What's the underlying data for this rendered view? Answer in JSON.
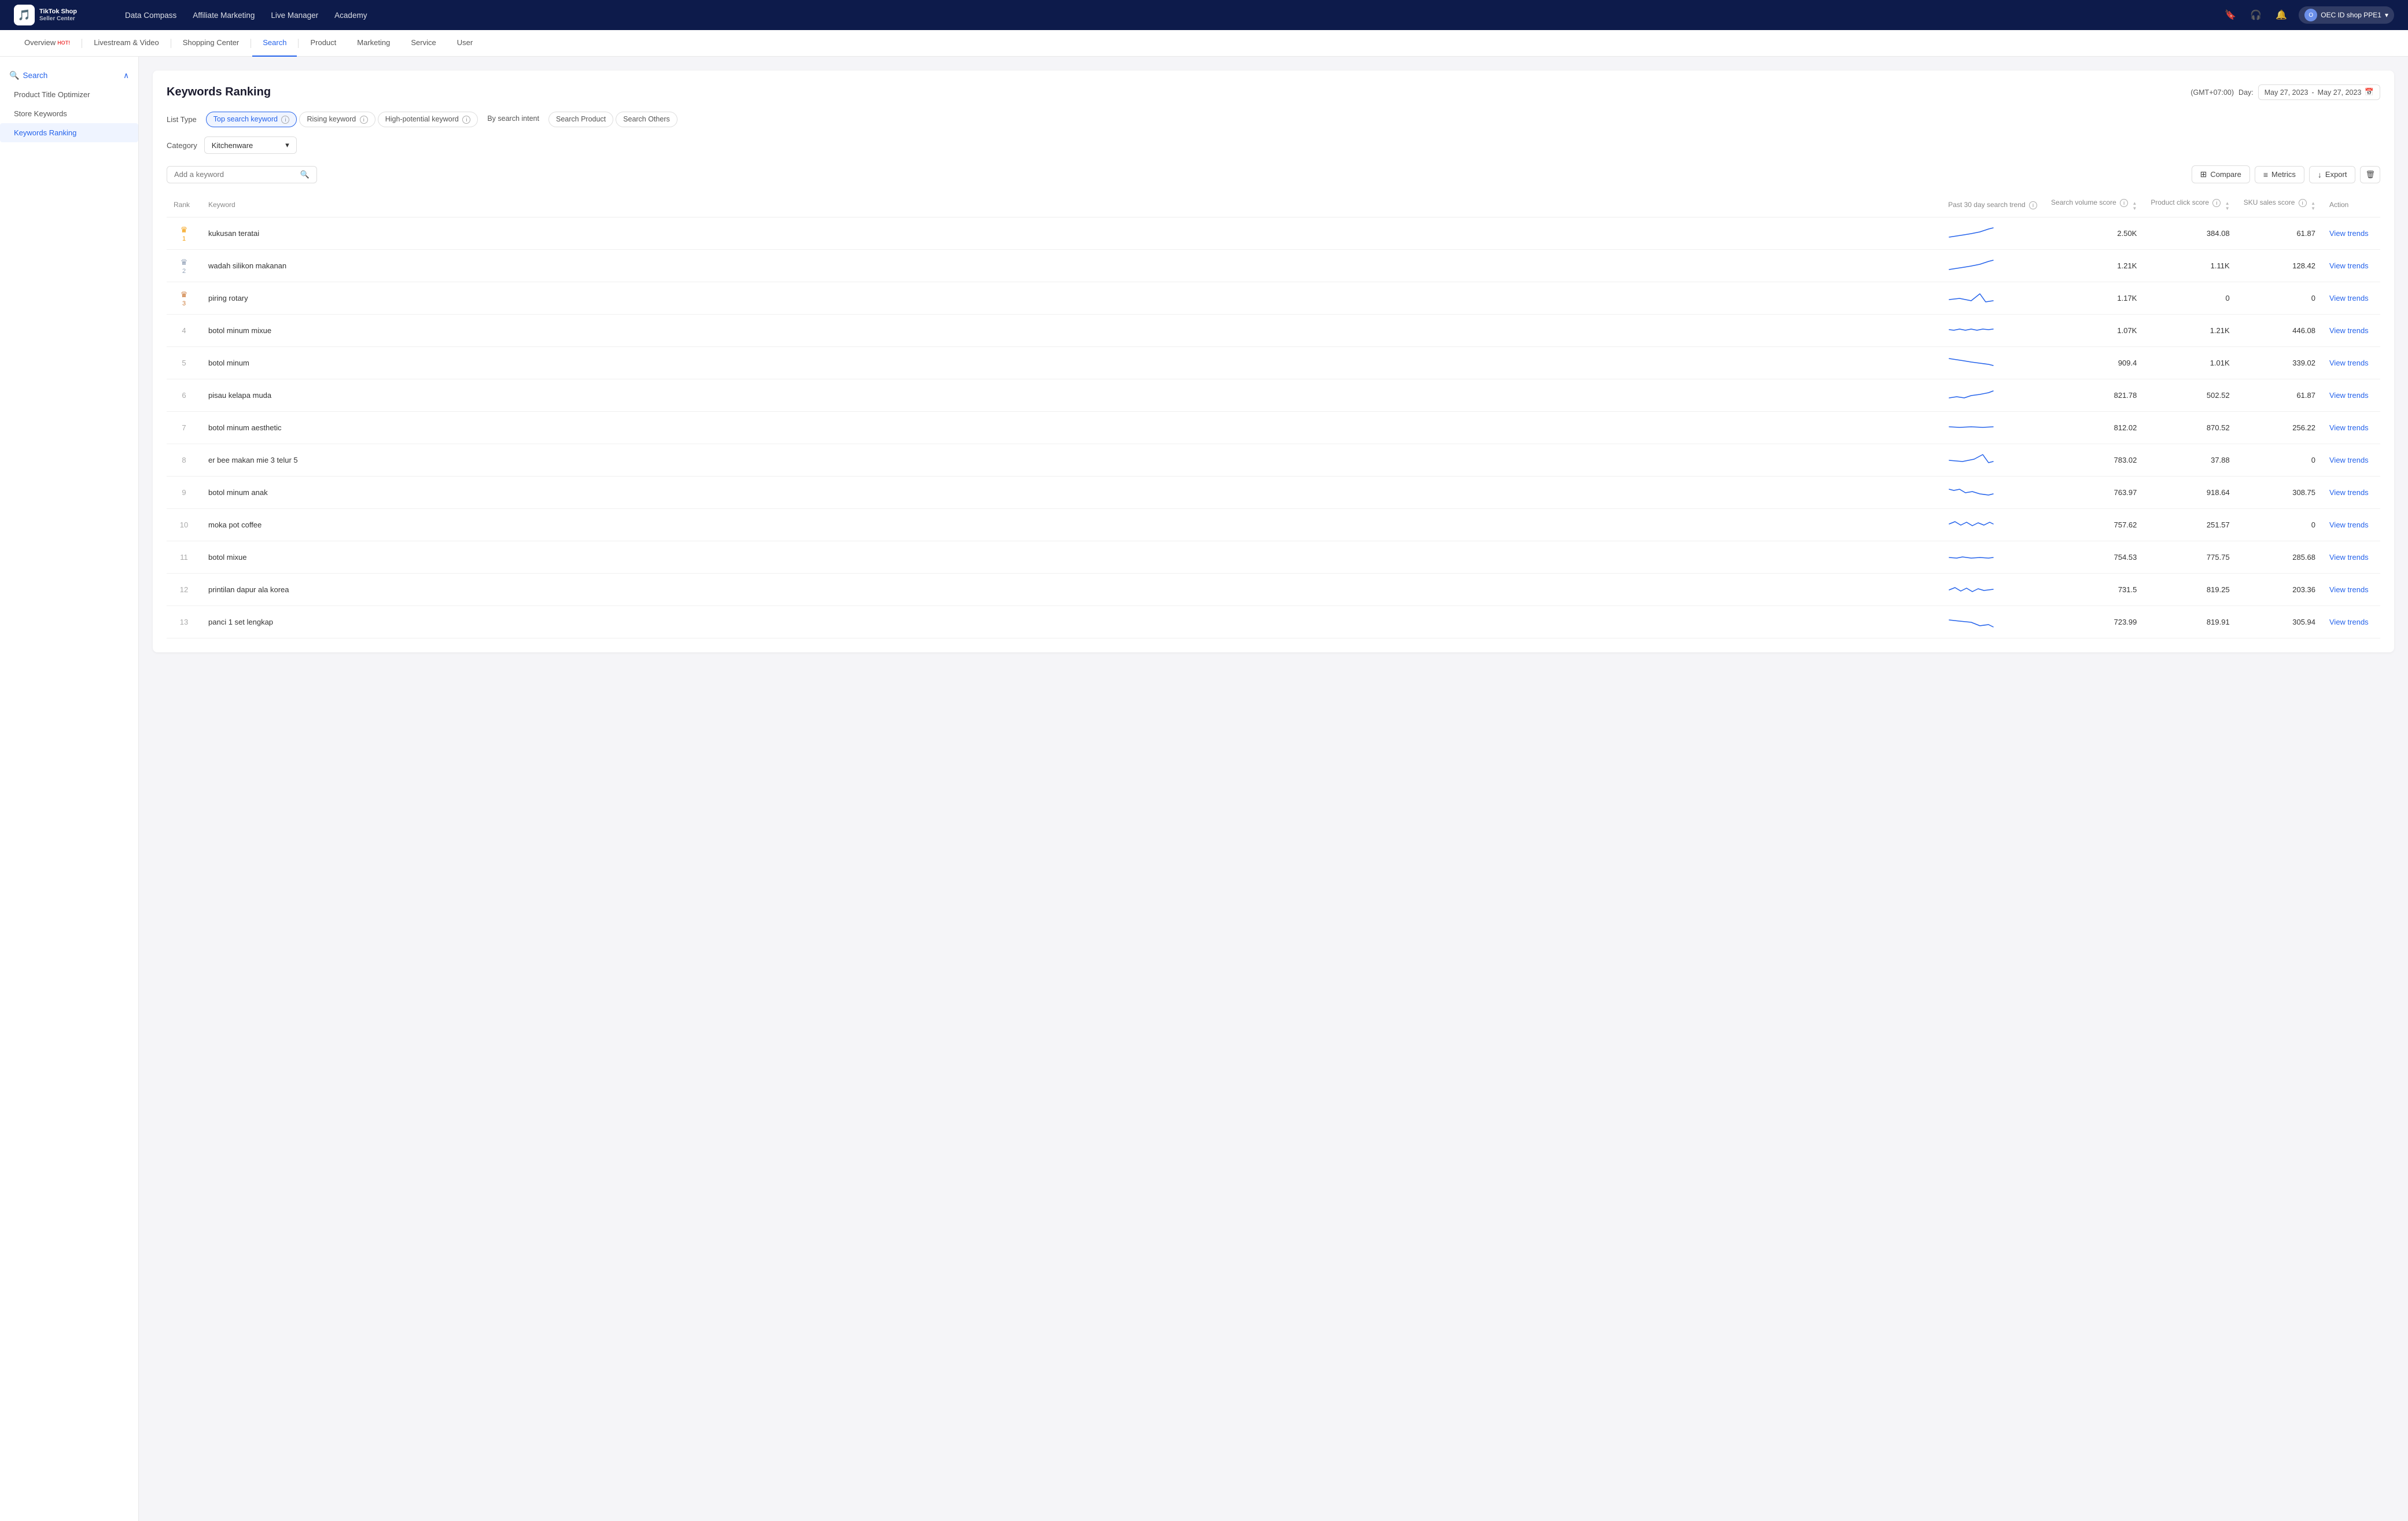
{
  "topNav": {
    "logo": "TikTok Shop Seller Center",
    "links": [
      "Data Compass",
      "Affiliate Marketing",
      "Live Manager",
      "Academy"
    ],
    "userLabel": "OEC ID shop PPE1"
  },
  "secondNav": {
    "items": [
      {
        "label": "Overview",
        "hot": true,
        "active": false
      },
      {
        "label": "Livestream & Video",
        "hot": false,
        "active": false
      },
      {
        "label": "Shopping Center",
        "hot": false,
        "active": false
      },
      {
        "label": "Search",
        "hot": false,
        "active": true
      },
      {
        "label": "Product",
        "hot": false,
        "active": false
      },
      {
        "label": "Marketing",
        "hot": false,
        "active": false
      },
      {
        "label": "Service",
        "hot": false,
        "active": false
      },
      {
        "label": "User",
        "hot": false,
        "active": false
      }
    ]
  },
  "sidebar": {
    "header": "Search",
    "items": [
      {
        "label": "Product Title Optimizer",
        "active": false
      },
      {
        "label": "Store Keywords",
        "active": false
      },
      {
        "label": "Keywords Ranking",
        "active": true
      }
    ]
  },
  "pageTitle": "Keywords Ranking",
  "timezone": "(GMT+07:00)",
  "dateLabel": "Day:",
  "dateFrom": "May 27, 2023",
  "dateTo": "May 27, 2023",
  "listType": {
    "label": "List Type",
    "tabs": [
      {
        "label": "Top search keyword",
        "active": true,
        "hasInfo": true
      },
      {
        "label": "Rising keyword",
        "active": false,
        "hasInfo": true
      },
      {
        "label": "High-potential keyword",
        "active": false,
        "hasInfo": true
      },
      {
        "label": "By search intent",
        "active": false,
        "hasInfo": false
      },
      {
        "label": "Search Product",
        "active": false,
        "hasInfo": false
      },
      {
        "label": "Search Others",
        "active": false,
        "hasInfo": false
      }
    ]
  },
  "category": {
    "label": "Category",
    "value": "Kitchenware"
  },
  "toolbar": {
    "searchPlaceholder": "Add a keyword",
    "compareLabel": "Compare",
    "metricsLabel": "Metrics",
    "exportLabel": "Export"
  },
  "tableHeaders": {
    "rank": "Rank",
    "keyword": "Keyword",
    "trend": "Past 30 day search trend",
    "searchVolume": "Search volume score",
    "productClick": "Product click score",
    "skuSales": "SKU sales score",
    "action": "Action"
  },
  "tableRows": [
    {
      "rank": 1,
      "rankCrown": true,
      "keyword": "kukusan teratai",
      "searchVolume": "2.50K",
      "productClick": "384.08",
      "skuSales": "61.87",
      "trendType": "up"
    },
    {
      "rank": 2,
      "rankCrown": true,
      "keyword": "wadah silikon makanan",
      "searchVolume": "1.21K",
      "productClick": "1.11K",
      "skuSales": "128.42",
      "trendType": "up"
    },
    {
      "rank": 3,
      "rankCrown": true,
      "keyword": "piring rotary",
      "searchVolume": "1.17K",
      "productClick": "0",
      "skuSales": "0",
      "trendType": "spike"
    },
    {
      "rank": 4,
      "rankCrown": false,
      "keyword": "botol minum mixue",
      "searchVolume": "1.07K",
      "productClick": "1.21K",
      "skuSales": "446.08",
      "trendType": "flat"
    },
    {
      "rank": 5,
      "rankCrown": false,
      "keyword": "botol minum",
      "searchVolume": "909.4",
      "productClick": "1.01K",
      "skuSales": "339.02",
      "trendType": "down"
    },
    {
      "rank": 6,
      "rankCrown": false,
      "keyword": "pisau kelapa muda",
      "searchVolume": "821.78",
      "productClick": "502.52",
      "skuSales": "61.87",
      "trendType": "up2"
    },
    {
      "rank": 7,
      "rankCrown": false,
      "keyword": "botol minum aesthetic",
      "searchVolume": "812.02",
      "productClick": "870.52",
      "skuSales": "256.22",
      "trendType": "flat2"
    },
    {
      "rank": 8,
      "rankCrown": false,
      "keyword": "er bee makan mie 3 telur 5",
      "searchVolume": "783.02",
      "productClick": "37.88",
      "skuSales": "0",
      "trendType": "spike2"
    },
    {
      "rank": 9,
      "rankCrown": false,
      "keyword": "botol minum anak",
      "searchVolume": "763.97",
      "productClick": "918.64",
      "skuSales": "308.75",
      "trendType": "down2"
    },
    {
      "rank": 10,
      "rankCrown": false,
      "keyword": "moka pot coffee",
      "searchVolume": "757.62",
      "productClick": "251.57",
      "skuSales": "0",
      "trendType": "wave"
    },
    {
      "rank": 11,
      "rankCrown": false,
      "keyword": "botol mixue",
      "searchVolume": "754.53",
      "productClick": "775.75",
      "skuSales": "285.68",
      "trendType": "flat3"
    },
    {
      "rank": 12,
      "rankCrown": false,
      "keyword": "printilan dapur ala korea",
      "searchVolume": "731.5",
      "productClick": "819.25",
      "skuSales": "203.36",
      "trendType": "wave2"
    },
    {
      "rank": 13,
      "rankCrown": false,
      "keyword": "panci 1 set lengkap",
      "searchVolume": "723.99",
      "productClick": "819.91",
      "skuSales": "305.94",
      "trendType": "down3"
    }
  ],
  "actionLabel": "View trends"
}
